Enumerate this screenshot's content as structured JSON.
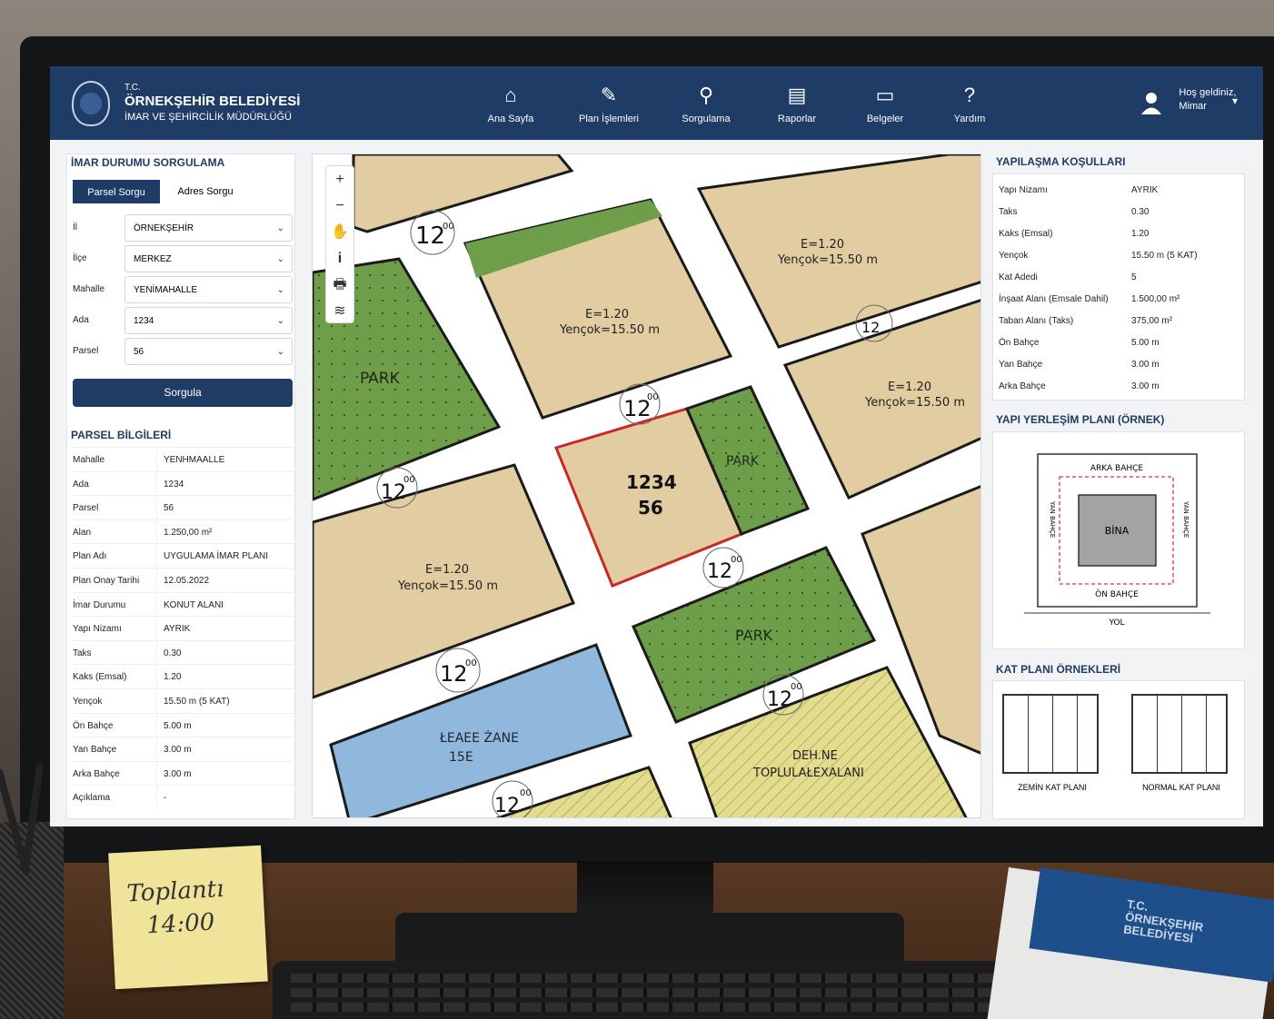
{
  "header": {
    "org_prefix": "T.C.",
    "org_name": "ÖRNEKŞEHİR BELEDİYESİ",
    "org_dept": "İMAR VE ŞEHİRCİLİK MÜDÜRLÜĞÜ",
    "nav": [
      {
        "label": "Ana Sayfa",
        "icon": "home-icon"
      },
      {
        "label": "Plan İşlemleri",
        "icon": "edit-plan-icon"
      },
      {
        "label": "Sorgulama",
        "icon": "search-icon"
      },
      {
        "label": "Raporlar",
        "icon": "report-icon"
      },
      {
        "label": "Belgeler",
        "icon": "folder-icon"
      },
      {
        "label": "Yardım",
        "icon": "help-icon"
      }
    ],
    "user_greeting": "Hoş geldiniz,",
    "user_name": "Mimar"
  },
  "query": {
    "title": "İMAR DURUMU SORGULAMA",
    "tabs": [
      "Parsel Sorgu",
      "Adres Sorgu"
    ],
    "fields": [
      {
        "label": "İl",
        "value": "ÖRNEKŞEHİR"
      },
      {
        "label": "İlçe",
        "value": "MERKEZ"
      },
      {
        "label": "Mahalle",
        "value": "YENİMAHALLE"
      },
      {
        "label": "Ada",
        "value": "1234"
      },
      {
        "label": "Parsel",
        "value": "56"
      }
    ],
    "submit": "Sorgula"
  },
  "parcel": {
    "title": "PARSEL BİLGİLERİ",
    "rows": [
      {
        "k": "Mahalle",
        "v": "YENHMAALLE"
      },
      {
        "k": "Ada",
        "v": "1234"
      },
      {
        "k": "Parsel",
        "v": "56"
      },
      {
        "k": "Alan",
        "v": "1.250,00 m²"
      },
      {
        "k": "Plan Adı",
        "v": "UYGULAMA İMAR PLANI"
      },
      {
        "k": "Plan Onay Tarihi",
        "v": "12.05.2022"
      },
      {
        "k": "İmar Durumu",
        "v": "KONUT ALANI"
      },
      {
        "k": "Yapı Nizamı",
        "v": "AYRIK"
      },
      {
        "k": "Taks",
        "v": "0.30"
      },
      {
        "k": "Kaks (Emsal)",
        "v": "1.20"
      },
      {
        "k": "Yençok",
        "v": "15.50 m (5 KAT)"
      },
      {
        "k": "Ön Bahçe",
        "v": "5.00 m"
      },
      {
        "k": "Yan Bahçe",
        "v": "3.00 m"
      },
      {
        "k": "Arka Bahçe",
        "v": "3.00 m"
      },
      {
        "k": "Açıklama",
        "v": "-"
      }
    ]
  },
  "map": {
    "tools": [
      "zoom-in-icon",
      "zoom-out-icon",
      "pan-hand-icon",
      "info-icon",
      "print-icon",
      "layers-icon"
    ],
    "tool_glyphs": [
      "+",
      "−",
      "✋",
      "i",
      "🖶",
      "≋"
    ],
    "selected_parcel": {
      "ada": "1234",
      "parsel": "56"
    },
    "labels": {
      "park": "PARK",
      "park2": "PARK",
      "park3": "PARK",
      "emsal": "E=1.20",
      "yencok": "Yençok=15.50 m",
      "road": "12",
      "road_sup": "00",
      "blue_zone": "ŁEAEE ŻANE",
      "blue_zone2": "15E",
      "yellow_zone": "DEH.NE",
      "yellow_zone2": "TOPLULAŁEXALANI"
    },
    "colors": {
      "residential": "#e2cda3",
      "park": "#6f9e4a",
      "blue": "#8fb8dc",
      "yellow": "#e3dc8c",
      "selected": "#c82828",
      "road": "#ffffff"
    }
  },
  "conditions": {
    "title": "YAPILAŞMA KOŞULLARI",
    "rows": [
      {
        "k": "Yapı Nizamı",
        "v": "AYRIK"
      },
      {
        "k": "Taks",
        "v": "0.30"
      },
      {
        "k": "Kaks (Emsal)",
        "v": "1.20"
      },
      {
        "k": "Yençok",
        "v": "15.50 m (5 KAT)"
      },
      {
        "k": "Kat Adedi",
        "v": "5"
      },
      {
        "k": "İnşaat Alanı (Emsale Dahil)",
        "v": "1.500,00 m²"
      },
      {
        "k": "Taban Alanı (Taks)",
        "v": "375,00 m²"
      },
      {
        "k": "Ön Bahçe",
        "v": "5.00 m"
      },
      {
        "k": "Yan Bahçe",
        "v": "3.00 m"
      },
      {
        "k": "Arka Bahçe",
        "v": "3.00 m"
      }
    ]
  },
  "site_plan": {
    "title": "YAPI YERLEŞİM PLANI (ÖRNEK)",
    "back": "ARKA BAHÇE",
    "front": "ÖN BAHÇE",
    "building": "BİNA",
    "road": "YOL",
    "side_left": "YAN BAHÇE",
    "side_right": "YAN BAHÇE"
  },
  "floors": {
    "title": "KAT PLANI ÖRNEKLERİ",
    "ground": "ZEMİN KAT PLANI",
    "normal": "NORMAL KAT PLANI"
  },
  "desk": {
    "sticky_line1": "Toplantı",
    "sticky_line2": "14:00",
    "booklet_text1": "T.C.",
    "booklet_text2": "ÖRNEKŞEHİR",
    "booklet_text3": "BELEDİYESİ"
  }
}
